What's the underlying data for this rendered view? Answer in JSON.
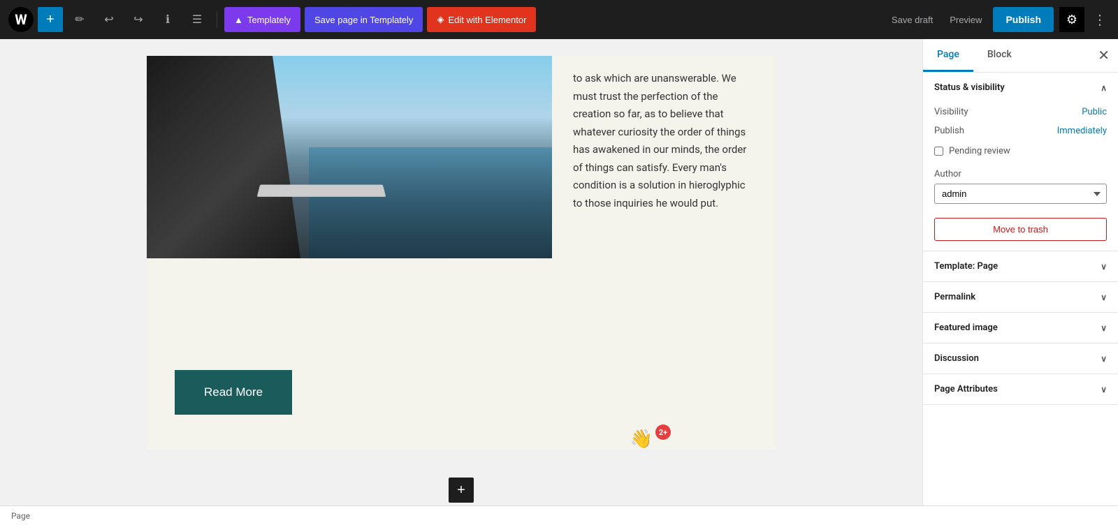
{
  "toolbar": {
    "add_btn": "+",
    "templately_label": "Templately",
    "save_templately_label": "Save page in Templately",
    "elementor_label": "Edit with Elementor",
    "save_draft_label": "Save draft",
    "preview_label": "Preview",
    "publish_label": "Publish",
    "more_options_label": "⋮"
  },
  "sidebar": {
    "page_tab": "Page",
    "block_tab": "Block",
    "close_label": "✕",
    "status_visibility_section": "Status & visibility",
    "visibility_label": "Visibility",
    "visibility_value": "Public",
    "publish_label": "Publish",
    "publish_value": "Immediately",
    "pending_review_label": "Pending review",
    "author_label": "Author",
    "author_value": "admin",
    "move_to_trash_label": "Move to trash",
    "template_label": "Template: Page",
    "permalink_label": "Permalink",
    "featured_image_label": "Featured image",
    "discussion_label": "Discussion",
    "page_attributes_label": "Page Attributes"
  },
  "editor": {
    "content_text": "to ask which are unanswerable. We must trust the perfection of the creation so far, as to believe that whatever curiosity the order of things has awakened in our minds, the order of things can satisfy. Every man's condition is a solution in hieroglyphic to those inquiries he would put.",
    "read_more_label": "Read More",
    "add_block_label": "+",
    "floating_emoji": "👋",
    "floating_badge": "2+"
  },
  "status_bar": {
    "label": "Page"
  }
}
